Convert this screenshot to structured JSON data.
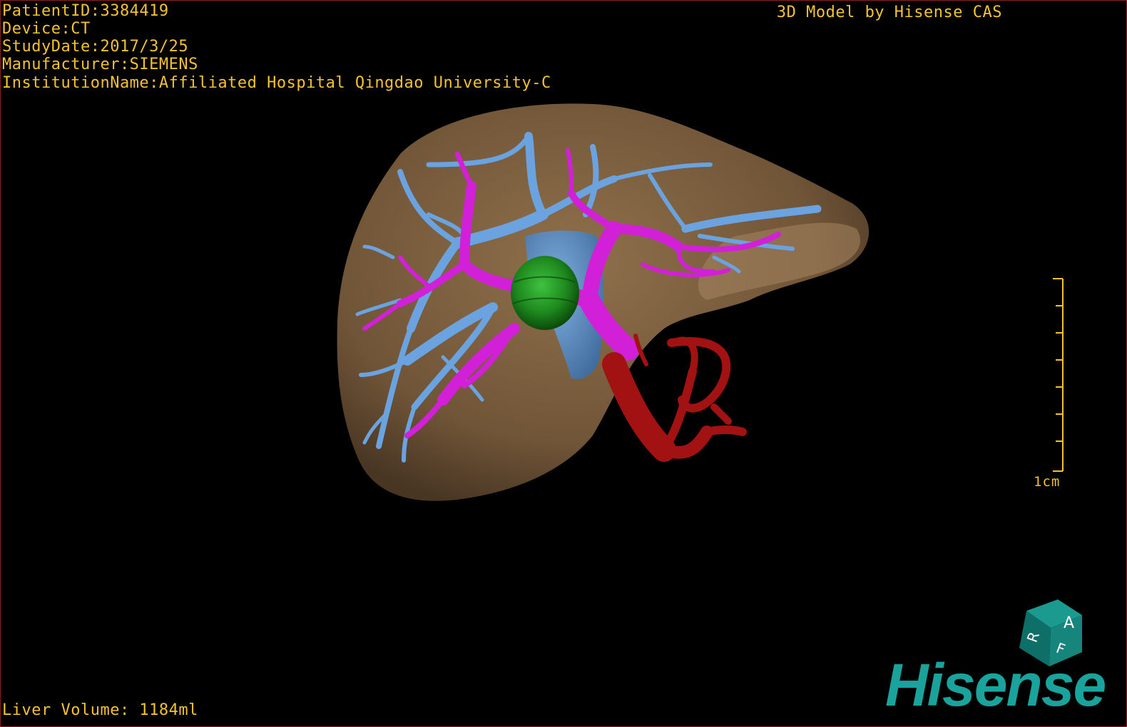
{
  "patient_info": {
    "patient_id": "PatientID:3384419",
    "device": "Device:CT",
    "study_date": "StudyDate:2017/3/25",
    "manufacturer": "Manufacturer:SIEMENS",
    "institution": "InstitutionName:Affiliated Hospital Qingdao University-C"
  },
  "credit": "3D Model by Hisense CAS",
  "liver_volume": "Liver Volume: 1184ml",
  "scale": {
    "label": "1cm"
  },
  "orientation_cube": {
    "face_top": "A",
    "face_left": "R",
    "face_bottom": "F"
  },
  "brand": "Hisense",
  "colors": {
    "text": "#f2c230",
    "liver": "#8a6a45",
    "portal_vein": "#d21fd8",
    "hepatic_vein": "#6aa3e0",
    "artery": "#a31212",
    "tumor": "#1f8a1f",
    "brand": "#1aa39c"
  }
}
